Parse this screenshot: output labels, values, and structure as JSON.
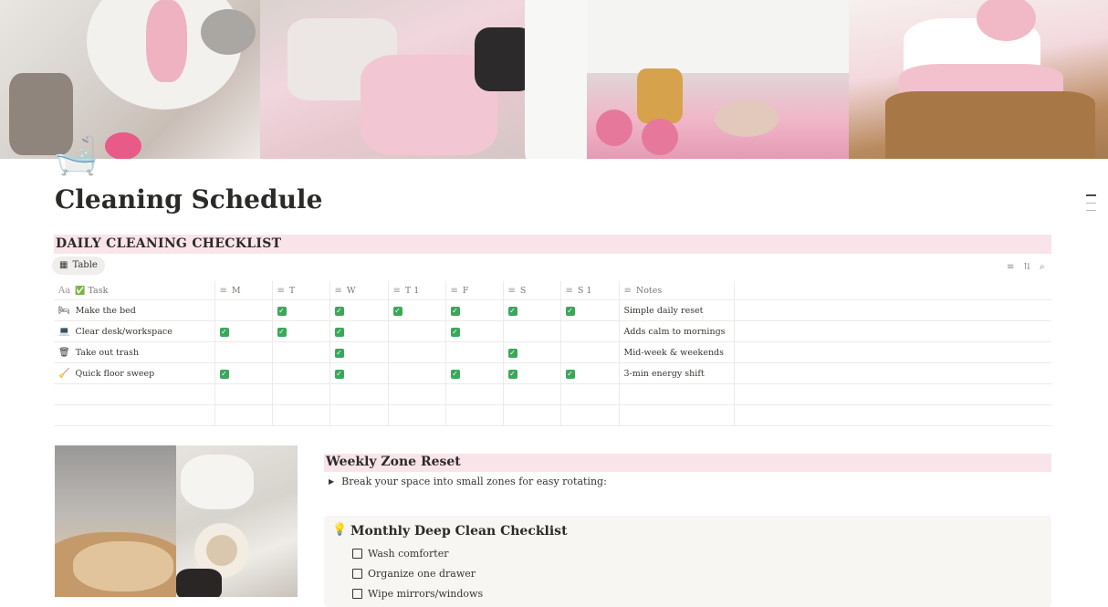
{
  "page": {
    "icon": "bathtub-icon",
    "icon_glyph": "🛁",
    "title": "Cleaning Schedule"
  },
  "daily": {
    "heading": "DAILY CLEANING CHECKLIST",
    "view_tab": "Table",
    "columns": [
      "Task",
      "M",
      "T",
      "W",
      "T 1",
      "F",
      "S",
      "S 1",
      "Notes"
    ],
    "rows": [
      {
        "emoji": "🛏",
        "task": "Make the bed",
        "checks": [
          false,
          true,
          true,
          true,
          true,
          true,
          true
        ],
        "notes": "Simple daily reset"
      },
      {
        "emoji": "💻",
        "task": "Clear desk/workspace",
        "checks": [
          true,
          true,
          true,
          false,
          true,
          false,
          false
        ],
        "notes": "Adds calm to mornings"
      },
      {
        "emoji": "🗑",
        "task": "Take out trash",
        "checks": [
          false,
          false,
          true,
          false,
          false,
          true,
          false
        ],
        "notes": "Mid-week & weekends"
      },
      {
        "emoji": "🧹",
        "task": "Quick floor sweep",
        "checks": [
          true,
          false,
          true,
          false,
          true,
          true,
          true
        ],
        "notes": "3-min energy shift"
      }
    ]
  },
  "weekly": {
    "heading": "Weekly Zone Reset",
    "toggle_text": "Break your space into small zones for easy rotating:"
  },
  "monthly": {
    "heading": "Monthly Deep Clean Checklist",
    "items": [
      "Wash comforter",
      "Organize one drawer",
      "Wipe mirrors/windows"
    ]
  },
  "colors": {
    "heading_band": "#f9e4ea",
    "check_green": "#3aa75b",
    "callout_bg": "#f7f6f3"
  }
}
